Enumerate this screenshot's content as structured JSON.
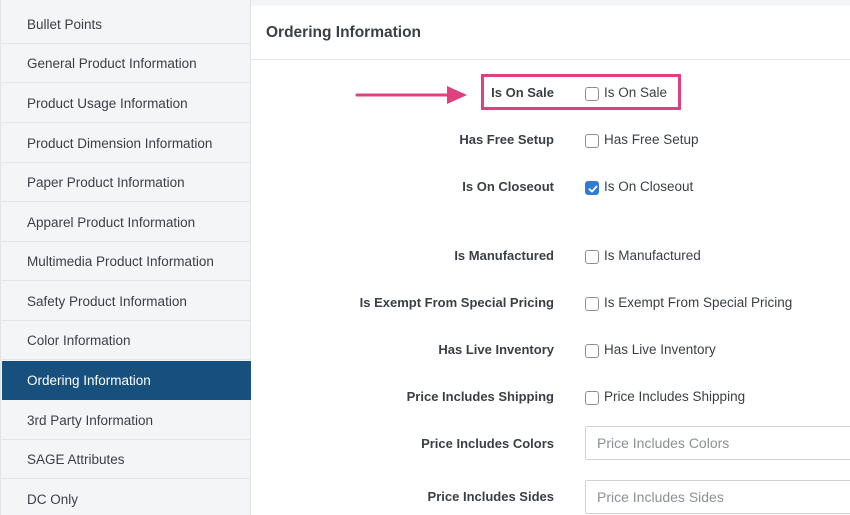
{
  "sidebar": {
    "items": [
      {
        "label": "Bullet Points"
      },
      {
        "label": "General Product Information"
      },
      {
        "label": "Product Usage Information"
      },
      {
        "label": "Product Dimension Information"
      },
      {
        "label": "Paper Product Information"
      },
      {
        "label": "Apparel Product Information"
      },
      {
        "label": "Multimedia Product Information"
      },
      {
        "label": "Safety Product Information"
      },
      {
        "label": "Color Information"
      },
      {
        "label": "Ordering Information"
      },
      {
        "label": "3rd Party Information"
      },
      {
        "label": "SAGE Attributes"
      },
      {
        "label": "DC Only"
      }
    ],
    "active_item": "Ordering Information"
  },
  "main": {
    "title": "Ordering Information",
    "fields": [
      {
        "label": "Is On Sale",
        "type": "checkbox",
        "checkbox_label": "Is On Sale",
        "checked": false,
        "highlighted": true
      },
      {
        "label": "Has Free Setup",
        "type": "checkbox",
        "checkbox_label": "Has Free Setup",
        "checked": false
      },
      {
        "label": "Is On Closeout",
        "type": "checkbox",
        "checkbox_label": "Is On Closeout",
        "checked": true
      },
      {
        "label": "Is Manufactured",
        "type": "checkbox",
        "checkbox_label": "Is Manufactured",
        "checked": false
      },
      {
        "label": "Is Exempt From Special Pricing",
        "type": "checkbox",
        "checkbox_label": "Is Exempt From Special Pricing",
        "checked": false
      },
      {
        "label": "Has Live Inventory",
        "type": "checkbox",
        "checkbox_label": "Has Live Inventory",
        "checked": false
      },
      {
        "label": "Price Includes Shipping",
        "type": "checkbox",
        "checkbox_label": "Price Includes Shipping",
        "checked": false
      },
      {
        "label": "Price Includes Colors",
        "type": "text",
        "value": "",
        "placeholder": "Price Includes Colors"
      },
      {
        "label": "Price Includes Sides",
        "type": "text",
        "value": "",
        "placeholder": "Price Includes Sides"
      }
    ]
  },
  "colors": {
    "sidebar_active_bg": "#18507d",
    "highlight_border": "#e0407f",
    "checkbox_checked": "#2f7bd6"
  },
  "annotation": {
    "arrow_icon": "right-arrow-icon",
    "highlight_target": "Is On Sale"
  }
}
